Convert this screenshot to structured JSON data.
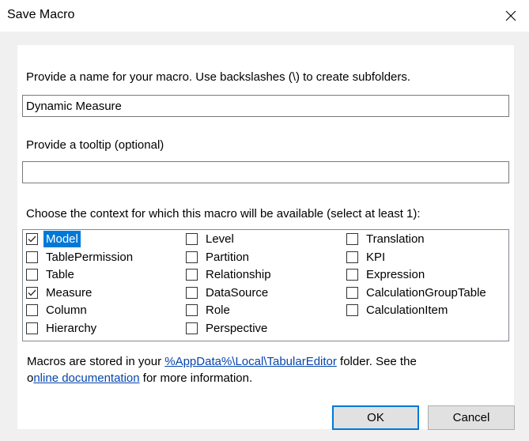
{
  "window": {
    "title": "Save Macro",
    "close_icon": "close-icon"
  },
  "name_section": {
    "label": "Provide a name for your macro. Use backslashes (\\) to create subfolders.",
    "value": "Dynamic Measure"
  },
  "tooltip_section": {
    "label": "Provide a tooltip (optional)",
    "value": ""
  },
  "context_section": {
    "label": "Choose the context for which this macro will be available (select at least 1):",
    "items": [
      {
        "label": "Model",
        "checked": true,
        "selected": true
      },
      {
        "label": "TablePermission",
        "checked": false
      },
      {
        "label": "Table",
        "checked": false
      },
      {
        "label": "Measure",
        "checked": true
      },
      {
        "label": "Column",
        "checked": false
      },
      {
        "label": "Hierarchy",
        "checked": false
      },
      {
        "label": "Level",
        "checked": false
      },
      {
        "label": "Partition",
        "checked": false
      },
      {
        "label": "Relationship",
        "checked": false
      },
      {
        "label": "DataSource",
        "checked": false
      },
      {
        "label": "Role",
        "checked": false
      },
      {
        "label": "Perspective",
        "checked": false
      },
      {
        "label": "Translation",
        "checked": false
      },
      {
        "label": "KPI",
        "checked": false
      },
      {
        "label": "Expression",
        "checked": false
      },
      {
        "label": "CalculationGroupTable",
        "checked": false
      },
      {
        "label": "CalculationItem",
        "checked": false
      }
    ]
  },
  "footer": {
    "text1": "Macros are stored in your ",
    "path_link": "%AppData%\\Local\\TabularEditor",
    "text2": " folder. See the",
    "text3": "o",
    "docs_link": "nline documentation",
    "text4": " for more information."
  },
  "buttons": {
    "ok": "OK",
    "cancel": "Cancel"
  },
  "colors": {
    "selection": "#0078d7",
    "link": "#0645ad",
    "default_button_border": "#0078d7"
  }
}
